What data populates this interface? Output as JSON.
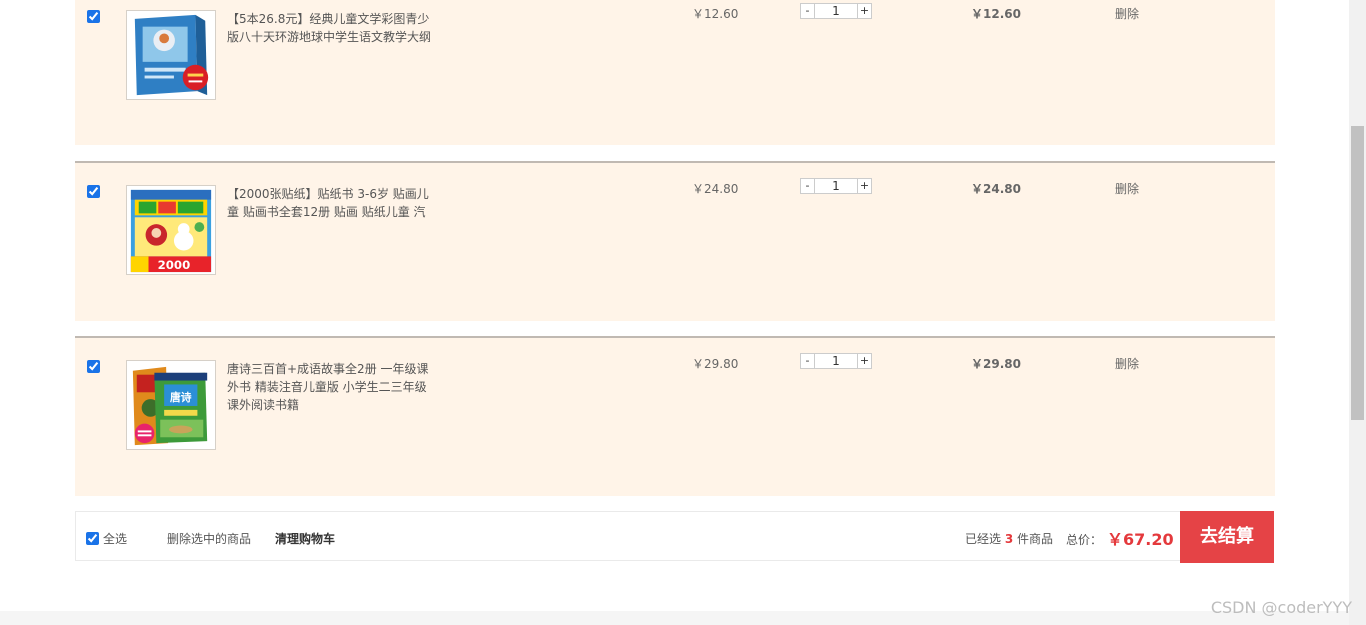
{
  "items": [
    {
      "title": "【5本26.8元】经典儿童文学彩图青少版八十天环游地球中学生语文教学大纲",
      "price": "￥12.60",
      "quantity": "1",
      "subtotal": "￥12.60",
      "delete_label": "删除",
      "checked": true,
      "image": "book-cover-80-days"
    },
    {
      "title": "【2000张贴纸】贴纸书 3-6岁 贴画儿童 贴画书全套12册 贴画 贴纸儿童 汽",
      "price": "￥24.80",
      "quantity": "1",
      "subtotal": "￥24.80",
      "delete_label": "删除",
      "checked": true,
      "image": "sticker-book-cover"
    },
    {
      "title": "唐诗三百首+成语故事全2册 一年级课外书 精装注音儿童版 小学生二三年级课外阅读书籍",
      "price": "￥29.80",
      "quantity": "1",
      "subtotal": "￥29.80",
      "delete_label": "删除",
      "checked": true,
      "image": "tang-poems-cover"
    }
  ],
  "qty_minus": "-",
  "qty_plus": "+",
  "footer": {
    "select_all_label": "全选",
    "delete_selected_label": "删除选中的商品",
    "clear_cart_label": "清理购物车",
    "selected_prefix": "已经选",
    "selected_count": "3",
    "selected_suffix": "件商品",
    "total_label": "总价：",
    "total_amount": "￥67.20",
    "checkout_label": "去结算"
  },
  "watermark": "CSDN @coderYYY",
  "colors": {
    "row_bg": "#fff4e8",
    "accent_red": "#e54346",
    "price_red": "#e4393c"
  }
}
